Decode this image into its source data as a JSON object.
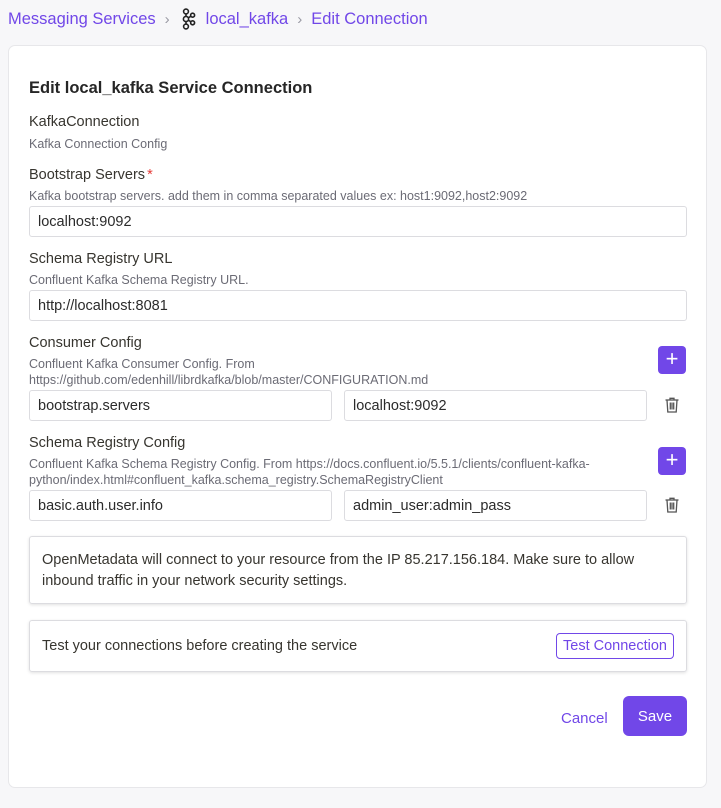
{
  "breadcrumb": {
    "root": "Messaging Services",
    "service": "local_kafka",
    "current": "Edit Connection",
    "service_icon": "kafka-icon"
  },
  "form": {
    "title": "Edit local_kafka Service Connection",
    "connection_type": "KafkaConnection",
    "connection_type_desc": "Kafka Connection Config",
    "bootstrap": {
      "label": "Bootstrap Servers",
      "required_mark": "*",
      "desc": "Kafka bootstrap servers. add them in comma separated values ex: host1:9092,host2:9092",
      "value": "localhost:9092"
    },
    "schema_registry_url": {
      "label": "Schema Registry URL",
      "desc": "Confluent Kafka Schema Registry URL.",
      "value": "http://localhost:8081"
    },
    "consumer_config": {
      "label": "Consumer Config",
      "desc_line1": "Confluent Kafka Consumer Config. From",
      "desc_line2": "https://github.com/edenhill/librdkafka/blob/master/CONFIGURATION.md",
      "key": "bootstrap.servers",
      "value": "localhost:9092"
    },
    "schema_registry_config": {
      "label": "Schema Registry Config",
      "desc_line1": "Confluent Kafka Schema Registry Config. From https://docs.confluent.io/5.5.1/clients/confluent-kafka-",
      "desc_line2": "python/index.html#confluent_kafka.schema_registry.SchemaRegistryClient",
      "key": "basic.auth.user.info",
      "value": "admin_user:admin_pass"
    },
    "info_text": "OpenMetadata will connect to your resource from the IP 85.217.156.184. Make sure to allow inbound traffic in your network security settings.",
    "test_text": "Test your connections before creating the service",
    "test_button": "Test Connection",
    "cancel_button": "Cancel",
    "save_button": "Save"
  },
  "colors": {
    "accent": "#7147e8",
    "required": "#e53935"
  }
}
